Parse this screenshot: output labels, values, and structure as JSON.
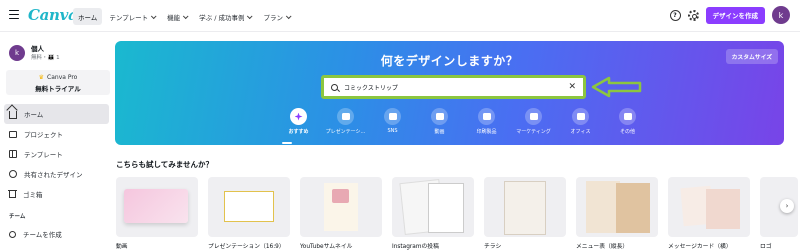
{
  "header": {
    "logo": "Canva",
    "nav": [
      {
        "label": "ホーム",
        "active": true,
        "dropdown": false
      },
      {
        "label": "テンプレート",
        "active": false,
        "dropdown": true
      },
      {
        "label": "機能",
        "active": false,
        "dropdown": true
      },
      {
        "label": "学ぶ / 成功事例",
        "active": false,
        "dropdown": true
      },
      {
        "label": "プラン",
        "active": false,
        "dropdown": true
      }
    ],
    "help_icon": "?",
    "create_button": "デザインを作成",
    "avatar_initial": "k",
    "accent_color": "#8b3dff"
  },
  "sidebar": {
    "avatar_initial": "k",
    "account_name": "個人",
    "account_sub": "無料・👪 1",
    "pro_title": "Canva Pro",
    "pro_action": "無料トライアル",
    "items": [
      {
        "label": "ホーム",
        "icon": "home-icon",
        "active": true
      },
      {
        "label": "プロジェクト",
        "icon": "folder-icon",
        "active": false
      },
      {
        "label": "テンプレート",
        "icon": "template-icon",
        "active": false
      },
      {
        "label": "共有されたデザイン",
        "icon": "shared-icon",
        "active": false
      },
      {
        "label": "ゴミ箱",
        "icon": "trash-icon",
        "active": false
      }
    ],
    "team_heading": "チーム",
    "team_create": "チームを作成"
  },
  "hero": {
    "title": "何をデザインしますか？",
    "custom_size": "カスタムサイズ",
    "search_value": "コミックストリップ",
    "search_placeholder": "",
    "categories": [
      {
        "label": "おすすめ",
        "active": true
      },
      {
        "label": "プレゼンテーシ...",
        "active": false
      },
      {
        "label": "SNS",
        "active": false
      },
      {
        "label": "動画",
        "active": false
      },
      {
        "label": "印刷製品",
        "active": false
      },
      {
        "label": "マーケティング",
        "active": false
      },
      {
        "label": "オフィス",
        "active": false
      },
      {
        "label": "その他",
        "active": false
      }
    ]
  },
  "suggestions": {
    "title": "こちらも試してみませんか？",
    "cards": [
      {
        "label": "動画"
      },
      {
        "label": "プレゼンテーション（16:9）"
      },
      {
        "label": "YouTubeサムネイル"
      },
      {
        "label": "Instagramの投稿"
      },
      {
        "label": "チラシ"
      },
      {
        "label": "メニュー表（縦長）"
      },
      {
        "label": "メッセージカード（横）"
      },
      {
        "label": "ロゴ"
      }
    ]
  }
}
